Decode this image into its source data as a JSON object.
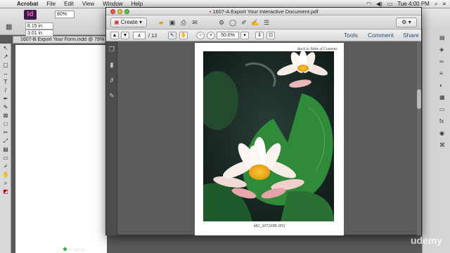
{
  "menubar": {
    "apple": "",
    "items": [
      "Acrobat",
      "File",
      "Edit",
      "View",
      "Window",
      "Help"
    ],
    "clock": "Tue 4:00 PM"
  },
  "indesign": {
    "logo": "Id",
    "zoom": "80%",
    "field_a": "8.15 in",
    "field_b": "3.01 in",
    "doc_tab": "1607-B Export Your Form.indd @ 79%",
    "status": "No errors"
  },
  "acrobat": {
    "title": "1607-A Export Your Interactive Document.pdf",
    "create_label": "Create",
    "customize_label": "Customize",
    "page_current": "4",
    "page_total": "/ 12",
    "zoom": "50.6%",
    "tools_label": "Tools",
    "comment_label": "Comment",
    "share_label": "Share"
  },
  "pdf": {
    "back_link": "Back to Table of Contents",
    "caption": "482_3071698.JPG"
  },
  "watermark": "udemy",
  "colors": {
    "lily_pad": "#2f8a3a",
    "petal": "#f6efe9",
    "center": "#f2b21a",
    "link": "#1f4f7a"
  }
}
